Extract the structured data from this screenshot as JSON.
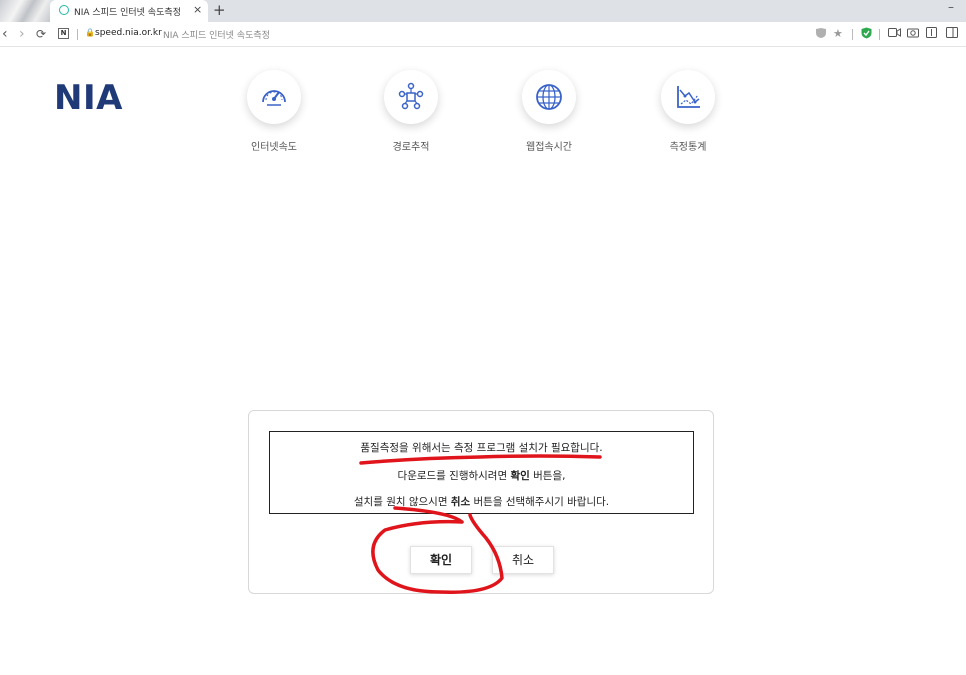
{
  "browser": {
    "tab_title": "NIA 스피드 인터넷 속도측정",
    "tab_close": "×",
    "new_tab": "+",
    "url": "speed.nia.or.kr",
    "page_label": "NIA 스피드 인터넷 속도측정",
    "site_badge": "N"
  },
  "header": {
    "logo": "NIA",
    "menu": [
      {
        "label": "인터넷속도",
        "icon": "speedometer-icon"
      },
      {
        "label": "경로추적",
        "icon": "route-trace-icon"
      },
      {
        "label": "웹접속시간",
        "icon": "globe-icon"
      },
      {
        "label": "측정통계",
        "icon": "statistics-icon"
      }
    ]
  },
  "dialog": {
    "line1": "품질측정을 위해서는 측정 프로그램 설치가 필요합니다.",
    "line2_pre": "다운로드를 진행하시려면 ",
    "line2_bold": "확인",
    "line2_post": " 버튼을,",
    "line3_pre": "설치를 원치 않으시면 ",
    "line3_bold": "취소",
    "line3_post": " 버튼을 선택해주시기 바랍니다.",
    "confirm_label": "확인",
    "cancel_label": "취소"
  },
  "colors": {
    "logo": "#1f3a77",
    "icon_blue": "#3a63c9",
    "annotation_red": "#e0141b"
  }
}
